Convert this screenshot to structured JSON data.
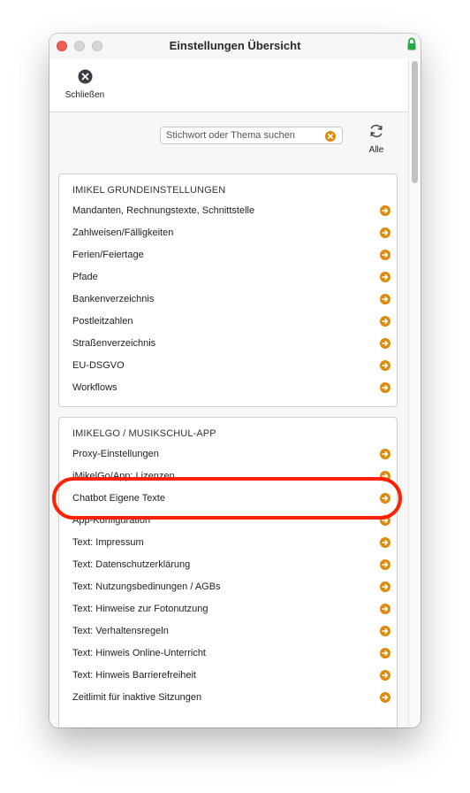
{
  "window": {
    "title": "Einstellungen Übersicht"
  },
  "toolbar": {
    "close_label": "Schließen"
  },
  "search": {
    "placeholder": "Stichwort oder Thema suchen",
    "all_label": "Alle"
  },
  "sections": [
    {
      "title": "IMIKEL GRUNDEINSTELLUNGEN",
      "items": [
        "Mandanten, Rechnungstexte, Schnittstelle",
        "Zahlweisen/Fälligkeiten",
        "Ferien/Feiertage",
        "Pfade",
        "Bankenverzeichnis",
        "Postleitzahlen",
        "Straßenverzeichnis",
        "EU-DSGVO",
        "Workflows"
      ]
    },
    {
      "title": "IMIKELGO / MUSIKSCHUL-APP",
      "items": [
        "Proxy-Einstellungen",
        "iMikelGo/App: Lizenzen",
        "Chatbot Eigene Texte",
        "App-Konfiguration",
        "Text: Impressum",
        "Text: Datenschutzerklärung",
        "Text: Nutzungsbedinungen / AGBs",
        "Text: Hinweise zur Fotonutzung",
        "Text: Verhaltensregeln",
        "Text: Hinweis Online-Unterricht",
        "Text: Hinweis Barrierefreiheit",
        "Zeitlimit für inaktive Sitzungen"
      ]
    }
  ],
  "colors": {
    "arrow": "#e08a0b",
    "highlight": "#ff2200",
    "close_red": "#ee5e57"
  }
}
